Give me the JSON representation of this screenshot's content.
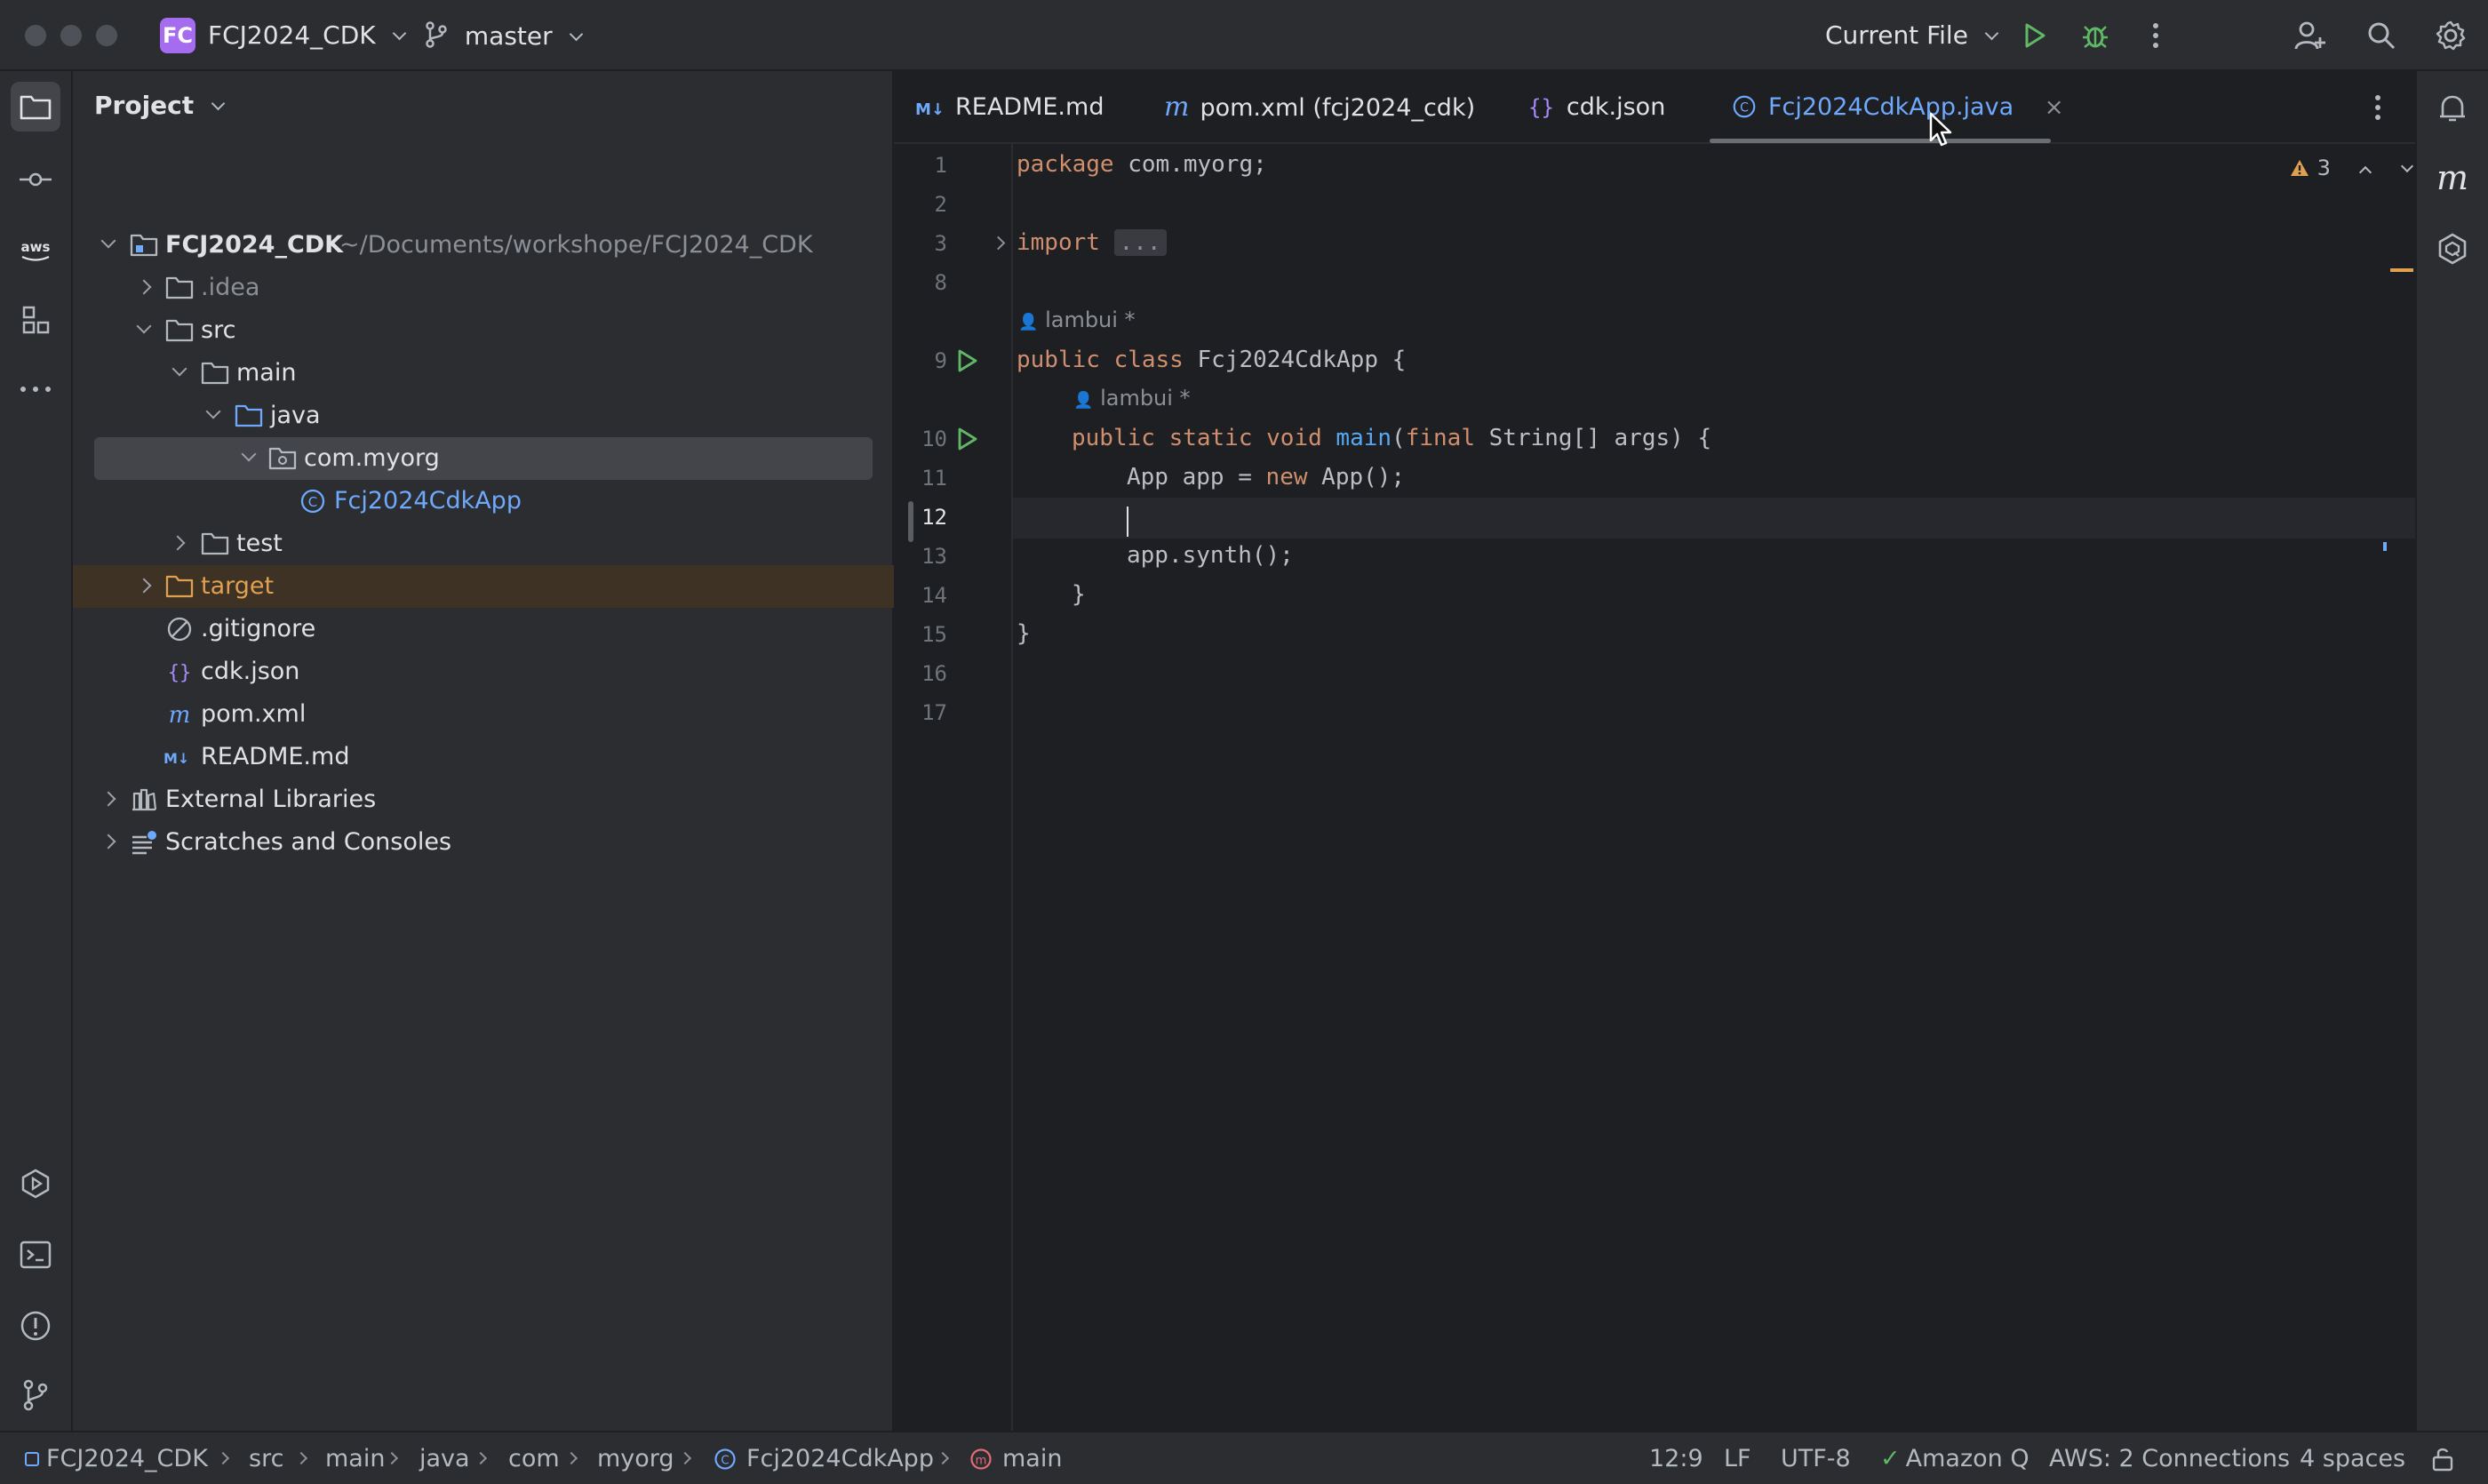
{
  "titlebar": {
    "project_badge": "FC",
    "project_name": "FCJ2024_CDK",
    "branch": "master",
    "run_config": "Current File"
  },
  "panel": {
    "title": "Project"
  },
  "tree": {
    "root_name": "FCJ2024_CDK",
    "root_path": "~/Documents/workshope/FCJ2024_CDK",
    "items": [
      ".idea",
      "src",
      "main",
      "java",
      "com.myorg",
      "Fcj2024CdkApp",
      "test",
      "target",
      ".gitignore",
      "cdk.json",
      "pom.xml",
      "README.md",
      "External Libraries",
      "Scratches and Consoles"
    ]
  },
  "tabs": [
    {
      "label": "README.md",
      "icon": "markdown-icon"
    },
    {
      "label": "pom.xml (fcj2024_cdk)",
      "icon": "maven-icon"
    },
    {
      "label": "cdk.json",
      "icon": "json-icon"
    },
    {
      "label": "Fcj2024CdkApp.java",
      "icon": "java-class-icon"
    }
  ],
  "editor": {
    "warnings": "3",
    "author": "lambui *",
    "line_numbers": [
      "1",
      "2",
      "3",
      "8",
      "9",
      "10",
      "11",
      "12",
      "13",
      "14",
      "15",
      "16",
      "17"
    ],
    "code": {
      "l1_kw": "package",
      "l1_rest": " com.myorg;",
      "l3_kw": "import",
      "l3_rest": "...",
      "l9_kw": "public class",
      "l9_rest": " Fcj2024CdkApp {",
      "l10_kw1": "public static void",
      "l10_fn": "main",
      "l10_p1": "(",
      "l10_kw2": "final",
      "l10_rest": " String[] args) {",
      "l11_a": "App app = ",
      "l11_kw": "new",
      "l11_b": " App();",
      "l13": "app.synth();",
      "l14": "}",
      "l15": "}"
    }
  },
  "statusbar": {
    "crumbs": [
      "FCJ2024_CDK",
      "src",
      "main",
      "java",
      "com",
      "myorg",
      "Fcj2024CdkApp",
      "main"
    ],
    "position": "12:9",
    "line_sep": "LF",
    "encoding": "UTF-8",
    "amazon_q": "Amazon Q",
    "aws": "AWS: 2 Connections",
    "indent": "4 spaces"
  },
  "colors": {
    "accent": "#6ea8ff",
    "badge": "#a56cf0",
    "target": "#e0a052",
    "run": "#5fb865"
  }
}
